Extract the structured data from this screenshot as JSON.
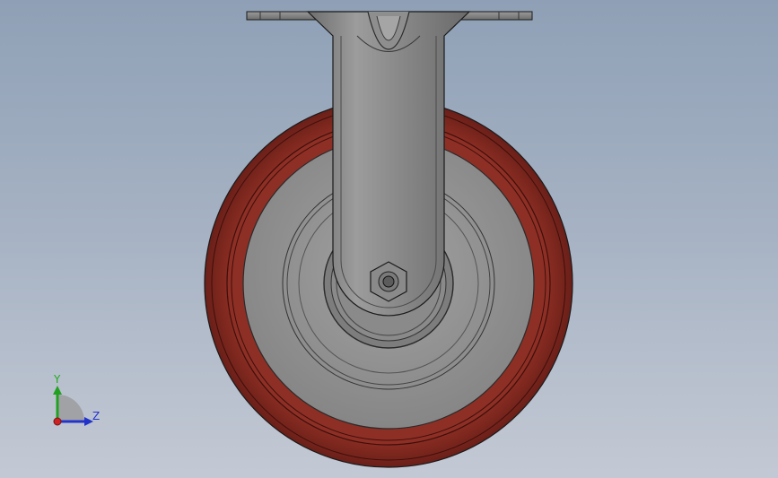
{
  "viewport": {
    "background_top": "#8fa0b6",
    "background_bottom": "#c3c9d4"
  },
  "model": {
    "name": "caster-wheel-model",
    "colors": {
      "tire": "#8a2f26",
      "tire_dark": "#5e1c16",
      "hub": "#8c8c8c",
      "hub_light": "#a6a6a6",
      "bracket": "#7a7a7a",
      "bracket_light": "#9a9a9a",
      "edge": "#1a1a1a"
    }
  },
  "triad": {
    "y_label": "Y",
    "z_label": "Z",
    "y_color": "#22a022",
    "z_color": "#2233cc",
    "x_color": "#cc2222",
    "label_color_y": "#22aa22",
    "label_color_z": "#2233cc"
  }
}
